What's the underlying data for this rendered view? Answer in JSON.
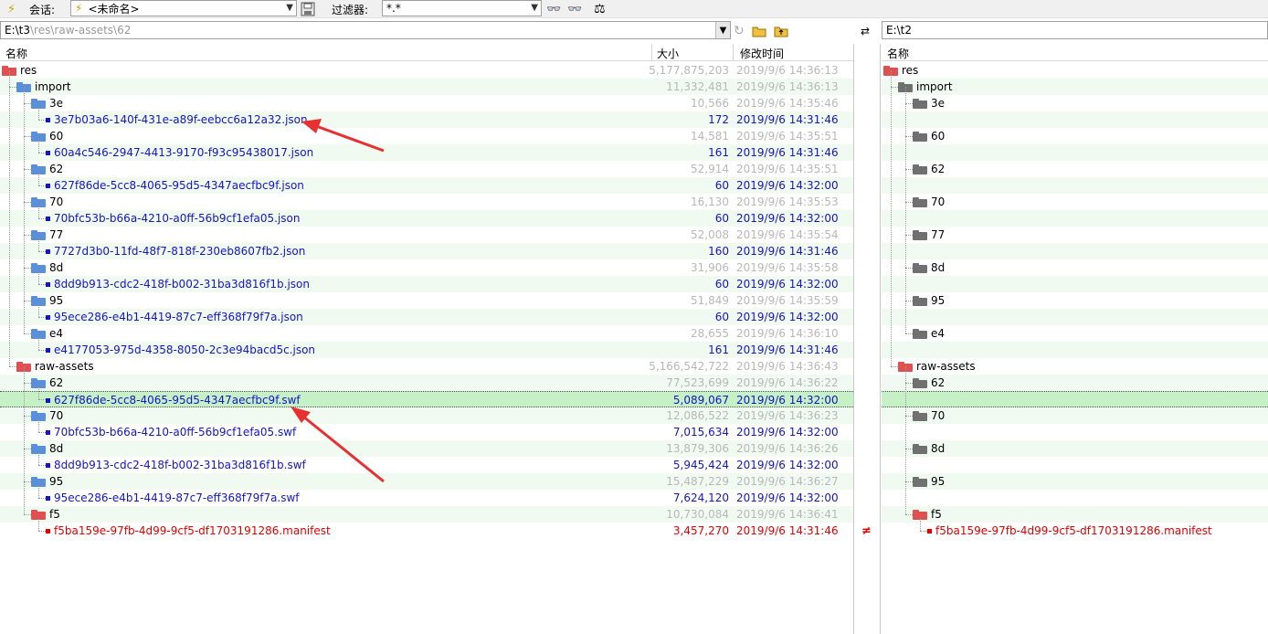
{
  "toolbar": {
    "session_label": "会话:",
    "session_value": "<未命名>",
    "filter_label": "过滤器:",
    "filter_value": "*.*"
  },
  "left": {
    "path_prefix": "E:\\t3",
    "path_dim": "\\res\\raw-assets\\62",
    "headers": {
      "name": "名称",
      "size": "大小",
      "time": "修改时间"
    },
    "rows": [
      {
        "name": "res",
        "type": "folder",
        "color": "red",
        "size": "5,177,875,203",
        "time": "2019/9/6 14:36:13",
        "level": 0,
        "dim": true
      },
      {
        "name": "import",
        "type": "folder",
        "color": "blue",
        "size": "11,332,481",
        "time": "2019/9/6 14:36:13",
        "level": 1,
        "dim": true
      },
      {
        "name": "3e",
        "type": "folder",
        "color": "blue",
        "size": "10,566",
        "time": "2019/9/6 14:35:46",
        "level": 2,
        "dim": true
      },
      {
        "name": "3e7b03a6-140f-431e-a89f-eebcc6a12a32.json",
        "type": "file",
        "color": "blue",
        "size": "172",
        "time": "2019/9/6 14:31:46",
        "level": 3
      },
      {
        "name": "60",
        "type": "folder",
        "color": "blue",
        "size": "14,581",
        "time": "2019/9/6 14:35:51",
        "level": 2,
        "dim": true
      },
      {
        "name": "60a4c546-2947-4413-9170-f93c95438017.json",
        "type": "file",
        "color": "blue",
        "size": "161",
        "time": "2019/9/6 14:31:46",
        "level": 3
      },
      {
        "name": "62",
        "type": "folder",
        "color": "blue",
        "size": "52,914",
        "time": "2019/9/6 14:35:51",
        "level": 2,
        "dim": true
      },
      {
        "name": "627f86de-5cc8-4065-95d5-4347aecfbc9f.json",
        "type": "file",
        "color": "blue",
        "size": "60",
        "time": "2019/9/6 14:32:00",
        "level": 3
      },
      {
        "name": "70",
        "type": "folder",
        "color": "blue",
        "size": "16,130",
        "time": "2019/9/6 14:35:53",
        "level": 2,
        "dim": true
      },
      {
        "name": "70bfc53b-b66a-4210-a0ff-56b9cf1efa05.json",
        "type": "file",
        "color": "blue",
        "size": "60",
        "time": "2019/9/6 14:32:00",
        "level": 3
      },
      {
        "name": "77",
        "type": "folder",
        "color": "blue",
        "size": "52,008",
        "time": "2019/9/6 14:35:54",
        "level": 2,
        "dim": true
      },
      {
        "name": "7727d3b0-11fd-48f7-818f-230eb8607fb2.json",
        "type": "file",
        "color": "blue",
        "size": "160",
        "time": "2019/9/6 14:31:46",
        "level": 3
      },
      {
        "name": "8d",
        "type": "folder",
        "color": "blue",
        "size": "31,906",
        "time": "2019/9/6 14:35:58",
        "level": 2,
        "dim": true
      },
      {
        "name": "8dd9b913-cdc2-418f-b002-31ba3d816f1b.json",
        "type": "file",
        "color": "blue",
        "size": "60",
        "time": "2019/9/6 14:32:00",
        "level": 3
      },
      {
        "name": "95",
        "type": "folder",
        "color": "blue",
        "size": "51,849",
        "time": "2019/9/6 14:35:59",
        "level": 2,
        "dim": true
      },
      {
        "name": "95ece286-e4b1-4419-87c7-eff368f79f7a.json",
        "type": "file",
        "color": "blue",
        "size": "60",
        "time": "2019/9/6 14:32:00",
        "level": 3
      },
      {
        "name": "e4",
        "type": "folder",
        "color": "blue",
        "size": "28,655",
        "time": "2019/9/6 14:36:10",
        "level": 2,
        "dim": true
      },
      {
        "name": "e4177053-975d-4358-8050-2c3e94bacd5c.json",
        "type": "file",
        "color": "blue",
        "size": "161",
        "time": "2019/9/6 14:31:46",
        "level": 3
      },
      {
        "name": "raw-assets",
        "type": "folder",
        "color": "red",
        "size": "5,166,542,722",
        "time": "2019/9/6 14:36:43",
        "level": 1,
        "dim": true
      },
      {
        "name": "62",
        "type": "folder",
        "color": "blue",
        "size": "77,523,699",
        "time": "2019/9/6 14:36:22",
        "level": 2,
        "dim": true
      },
      {
        "name": "627f86de-5cc8-4065-95d5-4347aecfbc9f.swf",
        "type": "file",
        "color": "blue",
        "size": "5,089,067",
        "time": "2019/9/6 14:32:00",
        "level": 3,
        "selected": true
      },
      {
        "name": "70",
        "type": "folder",
        "color": "blue",
        "size": "12,086,522",
        "time": "2019/9/6 14:36:23",
        "level": 2,
        "dim": true
      },
      {
        "name": "70bfc53b-b66a-4210-a0ff-56b9cf1efa05.swf",
        "type": "file",
        "color": "blue",
        "size": "7,015,634",
        "time": "2019/9/6 14:32:00",
        "level": 3
      },
      {
        "name": "8d",
        "type": "folder",
        "color": "blue",
        "size": "13,879,306",
        "time": "2019/9/6 14:36:26",
        "level": 2,
        "dim": true
      },
      {
        "name": "8dd9b913-cdc2-418f-b002-31ba3d816f1b.swf",
        "type": "file",
        "color": "blue",
        "size": "5,945,424",
        "time": "2019/9/6 14:32:00",
        "level": 3
      },
      {
        "name": "95",
        "type": "folder",
        "color": "blue",
        "size": "15,487,229",
        "time": "2019/9/6 14:36:27",
        "level": 2,
        "dim": true
      },
      {
        "name": "95ece286-e4b1-4419-87c7-eff368f79f7a.swf",
        "type": "file",
        "color": "blue",
        "size": "7,624,120",
        "time": "2019/9/6 14:32:00",
        "level": 3
      },
      {
        "name": "f5",
        "type": "folder",
        "color": "red",
        "size": "10,730,084",
        "time": "2019/9/6 14:36:41",
        "level": 2,
        "dim": true
      },
      {
        "name": "f5ba159e-97fb-4d99-9cf5-df1703191286.manifest",
        "type": "file",
        "color": "red",
        "size": "3,457,270",
        "time": "2019/9/6 14:31:46",
        "level": 3
      }
    ]
  },
  "mid": {
    "neq": "≠"
  },
  "right": {
    "path": "E:\\t2",
    "header_name": "名称",
    "rows": [
      {
        "name": "res",
        "type": "folder",
        "color": "red",
        "level": 0,
        "row": 0
      },
      {
        "name": "import",
        "type": "folder",
        "color": "gray",
        "level": 1,
        "row": 1
      },
      {
        "name": "3e",
        "type": "folder",
        "color": "gray",
        "level": 2,
        "row": 2
      },
      {
        "name": "60",
        "type": "folder",
        "color": "gray",
        "level": 2,
        "row": 4
      },
      {
        "name": "62",
        "type": "folder",
        "color": "gray",
        "level": 2,
        "row": 6
      },
      {
        "name": "70",
        "type": "folder",
        "color": "gray",
        "level": 2,
        "row": 8
      },
      {
        "name": "77",
        "type": "folder",
        "color": "gray",
        "level": 2,
        "row": 10
      },
      {
        "name": "8d",
        "type": "folder",
        "color": "gray",
        "level": 2,
        "row": 12
      },
      {
        "name": "95",
        "type": "folder",
        "color": "gray",
        "level": 2,
        "row": 14
      },
      {
        "name": "e4",
        "type": "folder",
        "color": "gray",
        "level": 2,
        "row": 16
      },
      {
        "name": "raw-assets",
        "type": "folder",
        "color": "red",
        "level": 1,
        "row": 18
      },
      {
        "name": "62",
        "type": "folder",
        "color": "gray",
        "level": 2,
        "row": 19
      },
      {
        "name": "70",
        "type": "folder",
        "color": "gray",
        "level": 2,
        "row": 21
      },
      {
        "name": "8d",
        "type": "folder",
        "color": "gray",
        "level": 2,
        "row": 23
      },
      {
        "name": "95",
        "type": "folder",
        "color": "gray",
        "level": 2,
        "row": 25
      },
      {
        "name": "f5",
        "type": "folder",
        "color": "red",
        "level": 2,
        "row": 27
      },
      {
        "name": "f5ba159e-97fb-4d99-9cf5-df1703191286.manifest",
        "type": "file",
        "color": "red",
        "level": 3,
        "row": 28
      }
    ]
  },
  "colors": {
    "selected_row": "#c6f0c6",
    "alt_row": "#f0faf0",
    "file_blue": "#1515c8",
    "diff_red": "#e00000",
    "annotation_arrow": "#e83030"
  }
}
